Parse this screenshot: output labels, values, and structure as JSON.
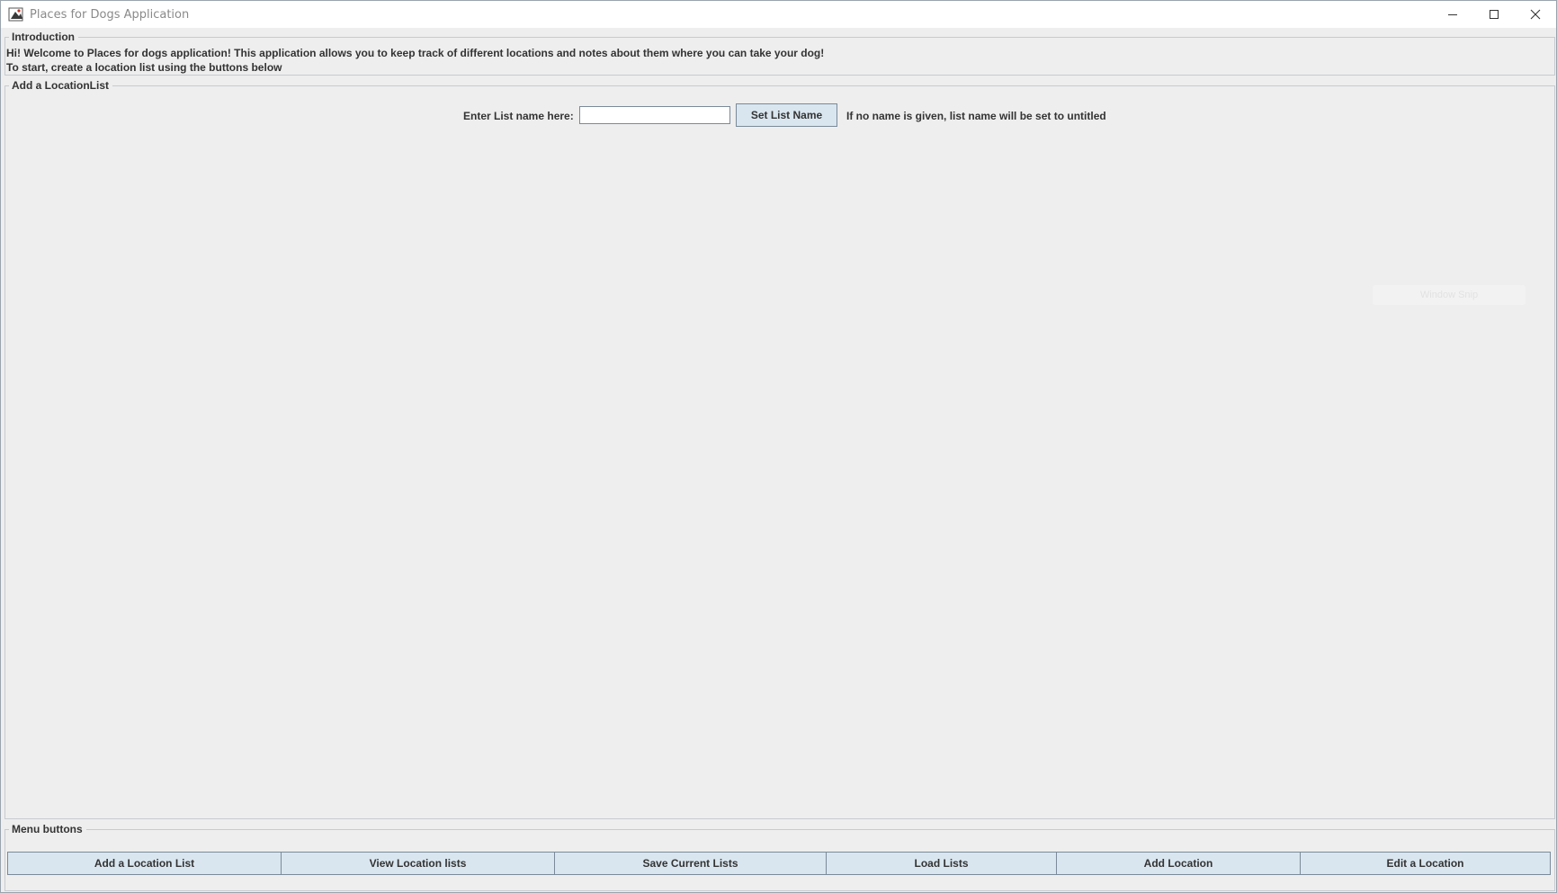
{
  "window": {
    "title": "Places for Dogs Application",
    "icon": "java-app-icon",
    "controls": [
      "minimize-icon",
      "maximize-icon",
      "close-icon"
    ]
  },
  "intro": {
    "title": "Introduction",
    "line1": "Hi! Welcome to Places for dogs application! This application allows you to keep track of different locations and notes about them where you can take your dog!",
    "line2": "To start, create a location list using the buttons below"
  },
  "add_list": {
    "title": "Add a LocationList",
    "label": "Enter List name here:",
    "input_value": "",
    "set_button": "Set List Name",
    "hint": "If no name is given, list name will be set to untitled"
  },
  "menu": {
    "title": "Menu buttons",
    "buttons": [
      "Add a Location List",
      "View Location lists",
      "Save Current Lists",
      "Load Lists",
      "Add Location",
      "Edit a Location"
    ]
  },
  "overlay": {
    "window_snip": "Window Snip"
  },
  "colors": {
    "background": "#eeeeee",
    "button": "#dae6ef",
    "button_border": "#7a8a99",
    "text": "#333333"
  }
}
